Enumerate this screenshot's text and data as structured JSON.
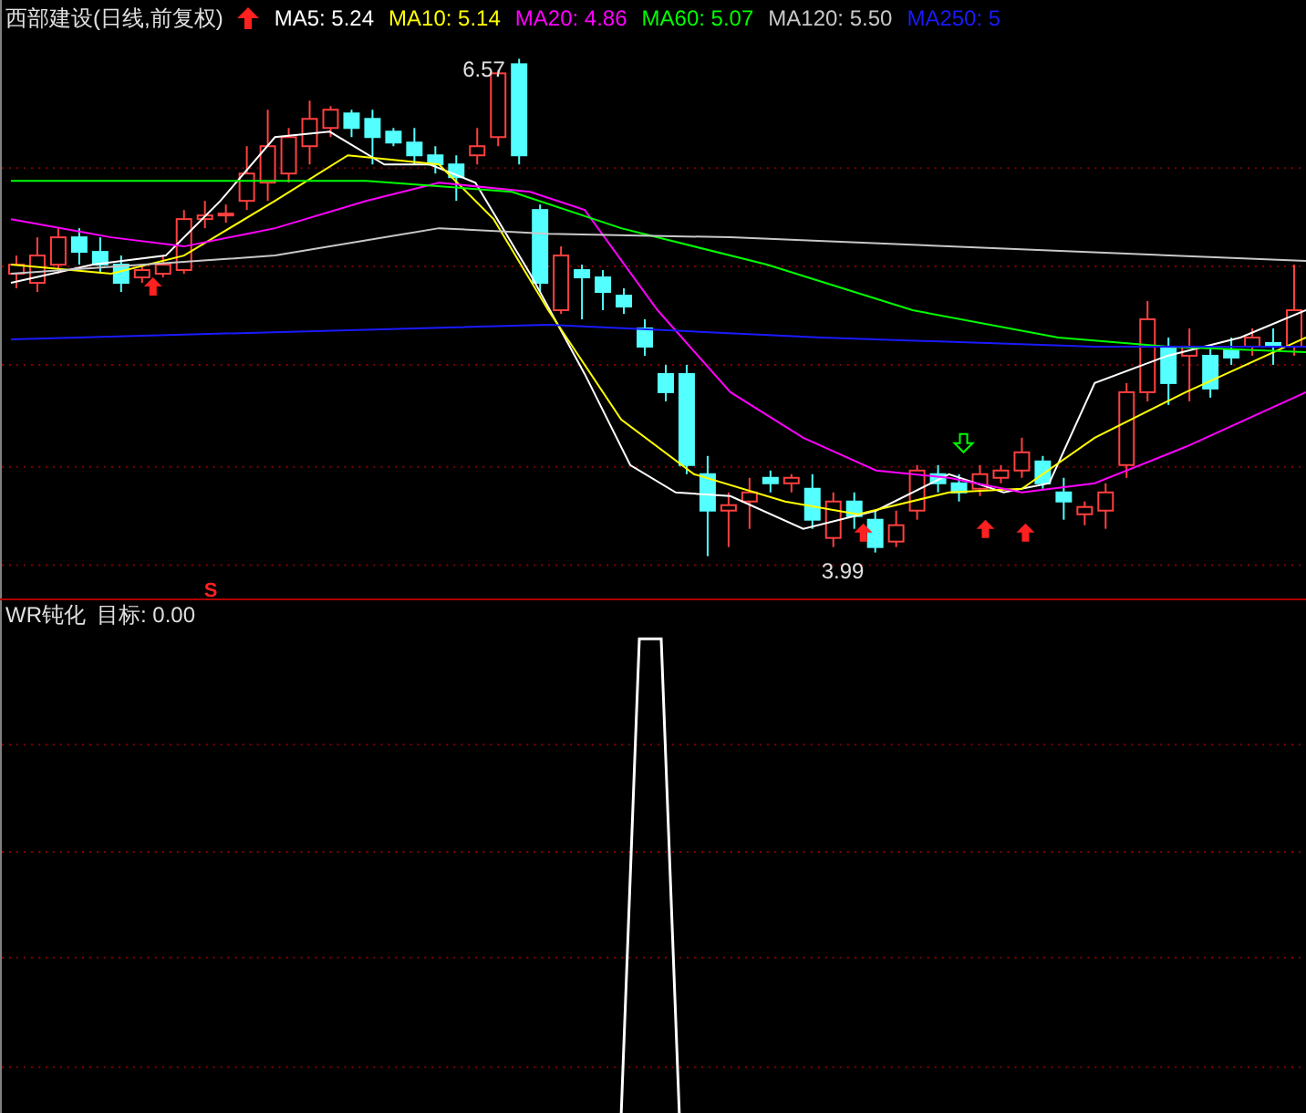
{
  "header": {
    "title": "西部建设(日线,前复权)",
    "indicators": [
      {
        "label": "MA5: 5.24",
        "color": "#ffffff"
      },
      {
        "label": "MA10: 5.14",
        "color": "#ffff00"
      },
      {
        "label": "MA20: 4.86",
        "color": "#ff00ff"
      },
      {
        "label": "MA60: 5.07",
        "color": "#00ff00"
      },
      {
        "label": "MA120: 5.50",
        "color": "#c8c8c8"
      },
      {
        "label": "MA250: 5",
        "color": "#1a1aff"
      }
    ]
  },
  "price_chart": {
    "high_label": "6.57",
    "low_label": "3.99",
    "signal_mark": "S"
  },
  "indicator_panel": {
    "name": "WR钝化",
    "target": "目标: 0.00"
  }
}
